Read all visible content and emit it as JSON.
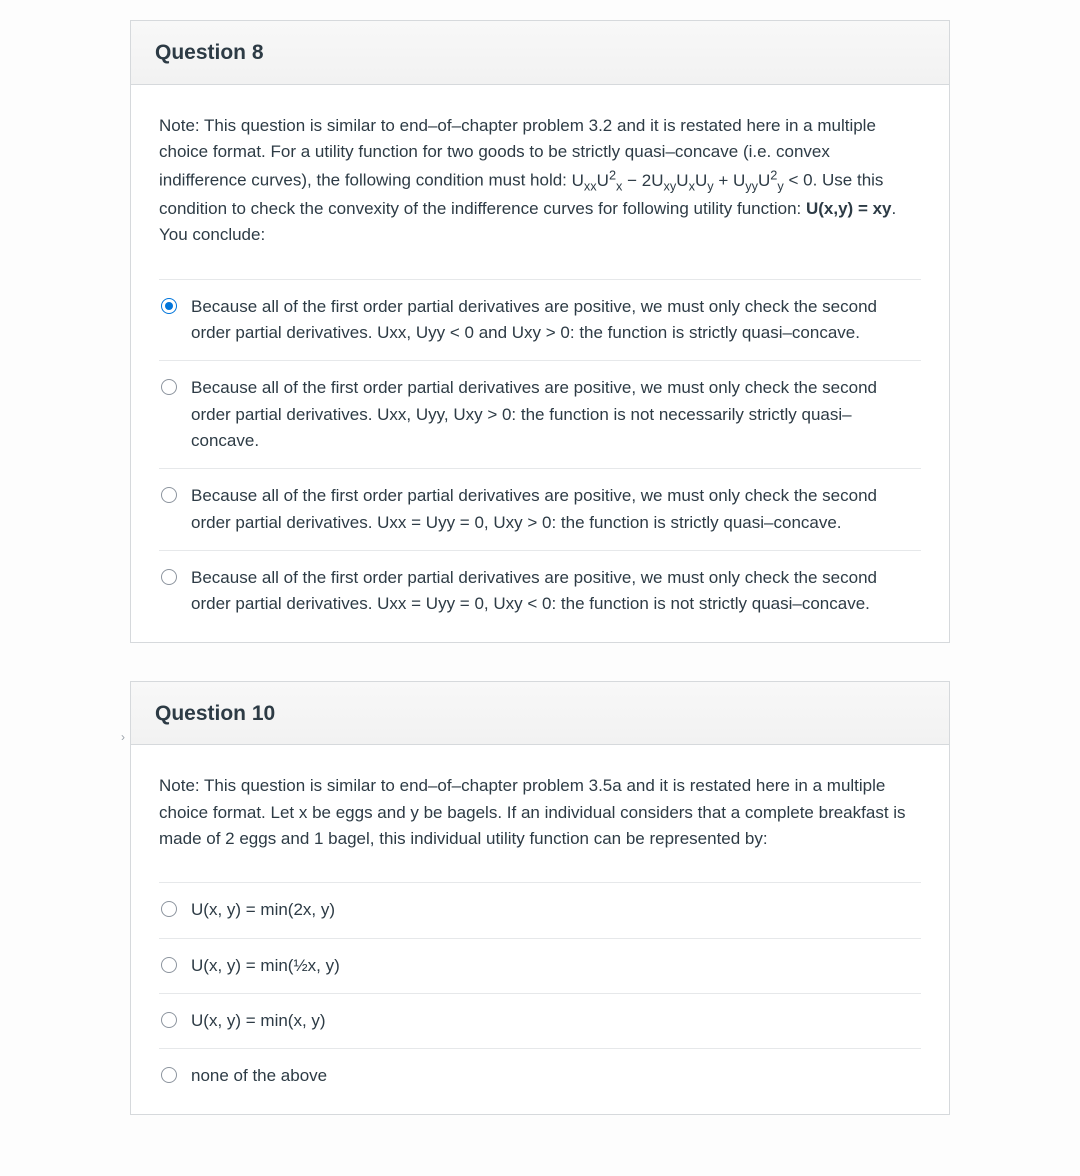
{
  "q1": {
    "title": "Question 8",
    "prompt_html": "Note: This question is similar to end–of–chapter problem 3.2 and it is restated here in a multiple choice format. For a utility function for two goods to be strictly quasi–concave (i.e. convex indifference curves), the following condition must hold: <span class=\"nowrap\">U<sub>xx</sub>U<sup>2</sup><sub>x</sub> − 2U<sub>xy</sub>U<sub>x</sub>U<sub>y</sub> + U<sub>yy</sub>U<sup>2</sup><sub>y</sub></span> &lt; 0. Use this condition to check the convexity of the indifference curves for following utility function: <b>U(x,y) = xy</b>. You conclude:",
    "options": [
      {
        "selected": true,
        "text": "Because all of the first order partial derivatives are positive, we must only check the second order partial derivatives. Uxx, Uyy < 0 and Uxy > 0: the function is strictly quasi–concave."
      },
      {
        "selected": false,
        "text": "Because all of the first order partial derivatives are positive, we must only check the second order partial derivatives. Uxx, Uyy, Uxy > 0: the function is not necessarily strictly quasi–concave."
      },
      {
        "selected": false,
        "text": "Because all of the first order partial derivatives are positive, we must only check the second order partial derivatives. Uxx = Uyy = 0, Uxy > 0: the function is strictly quasi–concave."
      },
      {
        "selected": false,
        "text": "Because all of the first order partial derivatives are positive, we must only check the second order partial derivatives. Uxx = Uyy = 0, Uxy < 0: the function is not strictly quasi–concave."
      }
    ]
  },
  "q2": {
    "title": "Question 10",
    "prompt_html": "Note: This question is similar to end–of–chapter problem 3.5a and it is restated here in a multiple choice format. Let x be eggs and y be bagels. If an individual considers that a complete breakfast is made of 2 eggs and 1 bagel, this individual utility function can be represented by:",
    "options": [
      {
        "selected": false,
        "text": "U(x, y) = min(2x, y)"
      },
      {
        "selected": false,
        "text": "U(x, y) = min(½x, y)"
      },
      {
        "selected": false,
        "text": "U(x, y) = min(x, y)"
      },
      {
        "selected": false,
        "text": "none of the above"
      }
    ]
  }
}
